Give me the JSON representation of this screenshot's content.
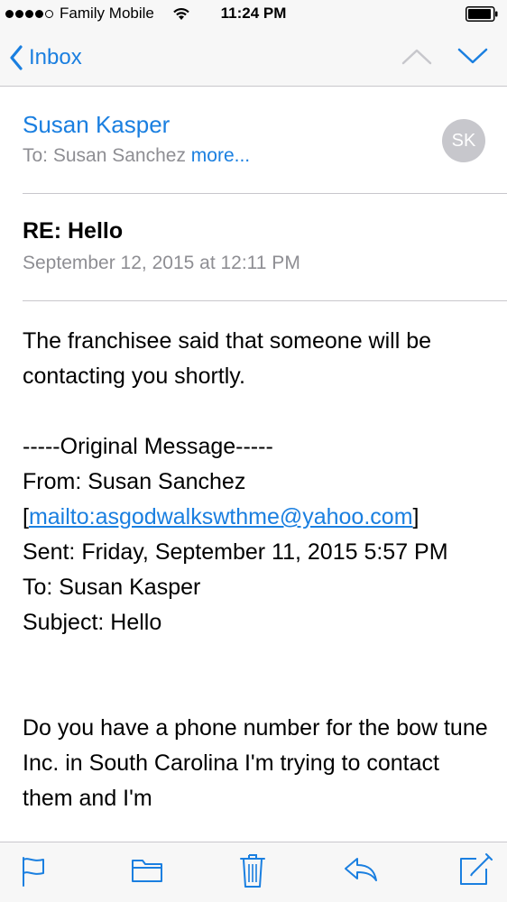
{
  "status": {
    "carrier": "Family Mobile",
    "time": "11:24 PM"
  },
  "nav": {
    "back_label": "Inbox",
    "prev_icon": "chevron-up-icon",
    "next_icon": "chevron-down-icon"
  },
  "header": {
    "sender": "Susan Kasper",
    "to_prefix": "To: Susan Sanchez ",
    "more": "more...",
    "avatar_initials": "SK",
    "subject": "RE: Hello",
    "date": "September 12, 2015 at 12:11 PM"
  },
  "body": {
    "intro": "The franchisee said that someone will be contacting you shortly.",
    "original_header": "-----Original Message-----",
    "from": "From: Susan Sanchez",
    "mailto_open": "[",
    "mailto": "mailto:asgodwalkswthme@yahoo.com",
    "mailto_close": "]",
    "sent": "Sent: Friday, September 11, 2015 5:57 PM",
    "to": "To: Susan Kasper",
    "subject": "Subject: Hello",
    "question": "Do you have a phone number for the bow tune Inc. in South Carolina I'm trying to contact them and I'm"
  },
  "toolbar": {
    "icons": [
      "flag-icon",
      "folder-icon",
      "trash-icon",
      "reply-icon",
      "compose-icon"
    ]
  },
  "colors": {
    "accent": "#1a7fe0",
    "secondary_text": "#8e8e93",
    "separator": "#c8c7cc"
  }
}
